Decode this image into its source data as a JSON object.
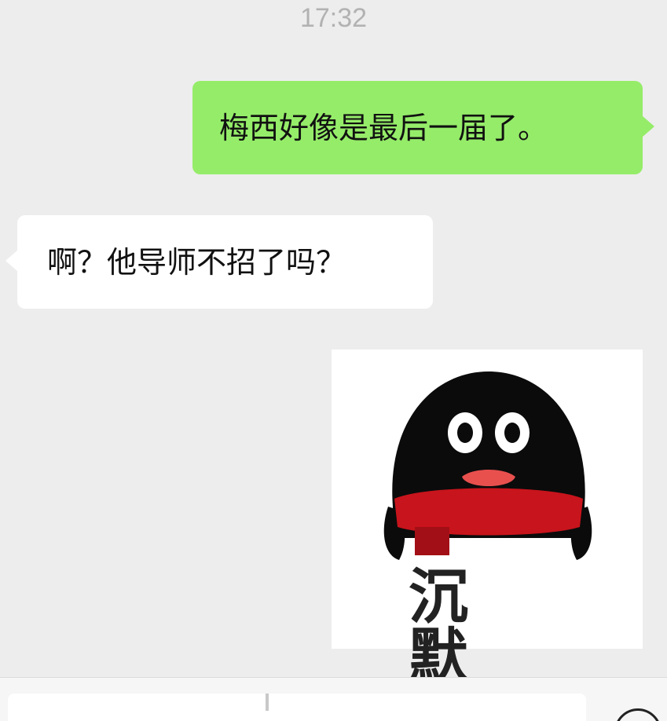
{
  "chat": {
    "timestamp": "17:32",
    "messages": [
      {
        "side": "sent",
        "text": "梅西好像是最后一届了。"
      },
      {
        "side": "received",
        "text": "啊？他导师不招了吗？"
      }
    ],
    "sticker": {
      "icon": "penguin-sticker",
      "caption": "沉默"
    }
  },
  "input_bar": {
    "emoji_icon": "emoji-icon"
  },
  "colors": {
    "background": "#ededed",
    "sent_bubble": "#95ec69",
    "received_bubble": "#ffffff"
  }
}
